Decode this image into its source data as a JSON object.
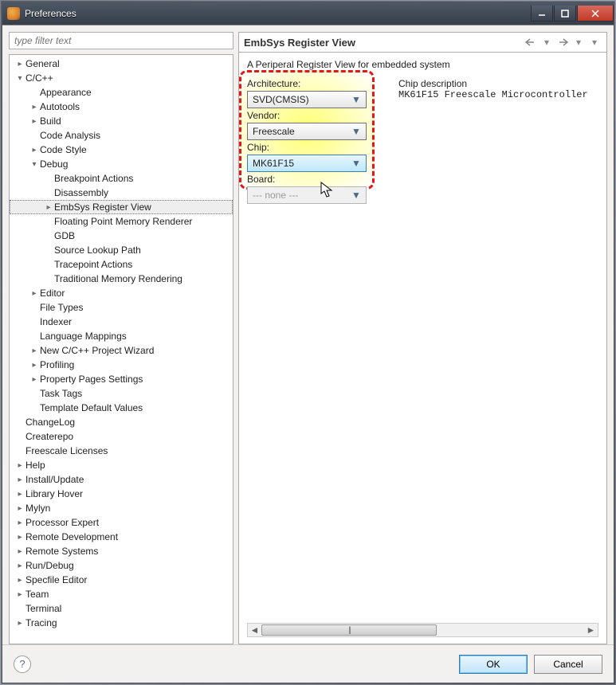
{
  "window": {
    "title": "Preferences"
  },
  "filter": {
    "placeholder": "type filter text"
  },
  "tree": [
    {
      "depth": 0,
      "tw": "closed",
      "label": "General"
    },
    {
      "depth": 0,
      "tw": "open",
      "label": "C/C++",
      "children": [
        {
          "depth": 1,
          "tw": "none",
          "label": "Appearance"
        },
        {
          "depth": 1,
          "tw": "closed",
          "label": "Autotools"
        },
        {
          "depth": 1,
          "tw": "closed",
          "label": "Build"
        },
        {
          "depth": 1,
          "tw": "none",
          "label": "Code Analysis"
        },
        {
          "depth": 1,
          "tw": "closed",
          "label": "Code Style"
        },
        {
          "depth": 1,
          "tw": "open",
          "label": "Debug",
          "children": [
            {
              "depth": 2,
              "tw": "none",
              "label": "Breakpoint Actions"
            },
            {
              "depth": 2,
              "tw": "none",
              "label": "Disassembly"
            },
            {
              "depth": 2,
              "tw": "closed",
              "label": "EmbSys Register View",
              "selected": true
            },
            {
              "depth": 2,
              "tw": "none",
              "label": "Floating Point Memory Renderer"
            },
            {
              "depth": 2,
              "tw": "none",
              "label": "GDB"
            },
            {
              "depth": 2,
              "tw": "none",
              "label": "Source Lookup Path"
            },
            {
              "depth": 2,
              "tw": "none",
              "label": "Tracepoint Actions"
            },
            {
              "depth": 2,
              "tw": "none",
              "label": "Traditional Memory Rendering"
            }
          ]
        },
        {
          "depth": 1,
          "tw": "closed",
          "label": "Editor"
        },
        {
          "depth": 1,
          "tw": "none",
          "label": "File Types"
        },
        {
          "depth": 1,
          "tw": "none",
          "label": "Indexer"
        },
        {
          "depth": 1,
          "tw": "none",
          "label": "Language Mappings"
        },
        {
          "depth": 1,
          "tw": "closed",
          "label": "New C/C++ Project Wizard"
        },
        {
          "depth": 1,
          "tw": "closed",
          "label": "Profiling"
        },
        {
          "depth": 1,
          "tw": "closed",
          "label": "Property Pages Settings"
        },
        {
          "depth": 1,
          "tw": "none",
          "label": "Task Tags"
        },
        {
          "depth": 1,
          "tw": "none",
          "label": "Template Default Values"
        }
      ]
    },
    {
      "depth": 0,
      "tw": "none",
      "label": "ChangeLog"
    },
    {
      "depth": 0,
      "tw": "none",
      "label": "Createrepo"
    },
    {
      "depth": 0,
      "tw": "none",
      "label": "Freescale Licenses"
    },
    {
      "depth": 0,
      "tw": "closed",
      "label": "Help"
    },
    {
      "depth": 0,
      "tw": "closed",
      "label": "Install/Update"
    },
    {
      "depth": 0,
      "tw": "closed",
      "label": "Library Hover"
    },
    {
      "depth": 0,
      "tw": "closed",
      "label": "Mylyn"
    },
    {
      "depth": 0,
      "tw": "closed",
      "label": "Processor Expert"
    },
    {
      "depth": 0,
      "tw": "closed",
      "label": "Remote Development"
    },
    {
      "depth": 0,
      "tw": "closed",
      "label": "Remote Systems"
    },
    {
      "depth": 0,
      "tw": "closed",
      "label": "Run/Debug"
    },
    {
      "depth": 0,
      "tw": "closed",
      "label": "Specfile Editor"
    },
    {
      "depth": 0,
      "tw": "closed",
      "label": "Team"
    },
    {
      "depth": 0,
      "tw": "none",
      "label": "Terminal"
    },
    {
      "depth": 0,
      "tw": "closed",
      "label": "Tracing"
    }
  ],
  "section": {
    "title": "EmbSys Register View",
    "description": "A Periperal Register View for embedded system"
  },
  "form": {
    "architecture_label": "Architecture:",
    "architecture_value": "SVD(CMSIS)",
    "vendor_label": "Vendor:",
    "vendor_value": "Freescale",
    "chip_label": "Chip:",
    "chip_value": "MK61F15",
    "board_label": "Board:",
    "board_value": "--- none ---"
  },
  "chip_description": {
    "label": "Chip description",
    "text": "MK61F15 Freescale Microcontroller"
  },
  "footer": {
    "ok": "OK",
    "cancel": "Cancel"
  }
}
